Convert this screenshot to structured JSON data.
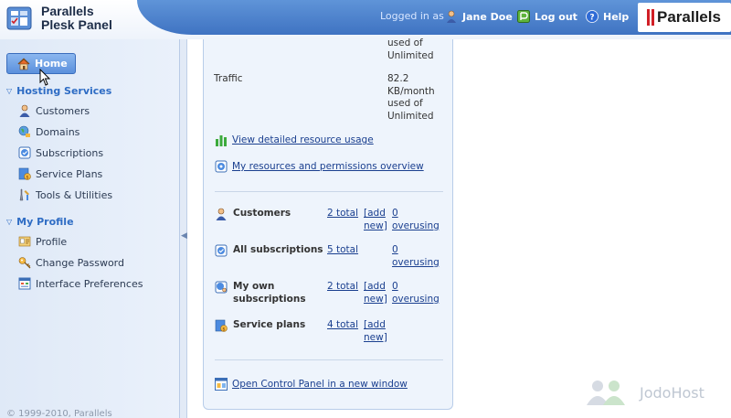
{
  "header": {
    "product_name_line1": "Parallels",
    "product_name_line2": "Plesk Panel",
    "logged_in_as": "Logged in as",
    "user_name": "Jane Doe",
    "logout": "Log out",
    "help": "Help",
    "brand": "Parallels"
  },
  "sidebar": {
    "home": "Home",
    "sections": [
      {
        "title": "Hosting Services",
        "items": [
          {
            "label": "Customers",
            "icon": "customers-icon"
          },
          {
            "label": "Domains",
            "icon": "domains-icon"
          },
          {
            "label": "Subscriptions",
            "icon": "subscriptions-icon"
          },
          {
            "label": "Service Plans",
            "icon": "service-plans-icon"
          },
          {
            "label": "Tools & Utilities",
            "icon": "tools-icon"
          }
        ]
      },
      {
        "title": "My Profile",
        "items": [
          {
            "label": "Profile",
            "icon": "profile-icon"
          },
          {
            "label": "Change Password",
            "icon": "key-icon"
          },
          {
            "label": "Interface Preferences",
            "icon": "preferences-icon"
          }
        ]
      }
    ],
    "copyright": "© 1999-2010, Parallels"
  },
  "main": {
    "prev_usage_tail": [
      "used of",
      "Unlimited"
    ],
    "traffic": {
      "label": "Traffic",
      "value": [
        "82.2",
        "KB/month",
        "used of",
        "Unlimited"
      ]
    },
    "view_usage_link": "View detailed resource usage",
    "resources_link": "My resources and permissions overview",
    "summary_rows": [
      {
        "name": "Customers",
        "total": "2 total",
        "add": "[add new]",
        "over_count": "0",
        "over_label": "overusing"
      },
      {
        "name": "All subscriptions",
        "total": "5 total",
        "add": "",
        "over_count": "0",
        "over_label": "overusing"
      },
      {
        "name": "My own subscriptions",
        "total": "2 total",
        "add": "[add new]",
        "over_count": "0",
        "over_label": "overusing"
      },
      {
        "name": "Service plans",
        "total": "4 total",
        "add": "[add new]",
        "over_count": "",
        "over_label": ""
      }
    ],
    "control_panel_link": "Open Control Panel in a new window"
  },
  "watermark": "JodoHost",
  "colors": {
    "accent": "#3f73c2",
    "link": "#1a3f8f",
    "section_title": "#2e6cc4",
    "brand_red": "#d11f26"
  }
}
